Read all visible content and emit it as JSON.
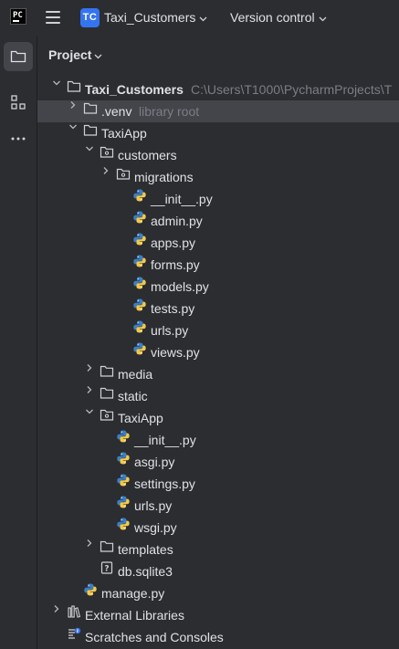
{
  "titlebar": {
    "project_badge": "TC",
    "project_name": "Taxi_Customers",
    "version_control": "Version control"
  },
  "panel": {
    "title": "Project"
  },
  "tree": [
    {
      "label": "Taxi_Customers",
      "hint": "C:\\Users\\T1000\\PycharmProjects\\T",
      "type": "folder",
      "arrow": "down",
      "bold": true
    },
    {
      "label": ".venv",
      "hint": "library root",
      "type": "folder",
      "arrow": "right",
      "selected": true
    },
    {
      "label": "TaxiApp",
      "type": "folder",
      "arrow": "down"
    },
    {
      "label": "customers",
      "type": "package",
      "arrow": "down"
    },
    {
      "label": "migrations",
      "type": "package",
      "arrow": "right"
    },
    {
      "label": "__init__.py",
      "type": "python"
    },
    {
      "label": "admin.py",
      "type": "python"
    },
    {
      "label": "apps.py",
      "type": "python"
    },
    {
      "label": "forms.py",
      "type": "python"
    },
    {
      "label": "models.py",
      "type": "python"
    },
    {
      "label": "tests.py",
      "type": "python"
    },
    {
      "label": "urls.py",
      "type": "python"
    },
    {
      "label": "views.py",
      "type": "python"
    },
    {
      "label": "media",
      "type": "folder",
      "arrow": "right"
    },
    {
      "label": "static",
      "type": "folder",
      "arrow": "right"
    },
    {
      "label": "TaxiApp",
      "type": "package",
      "arrow": "down"
    },
    {
      "label": "__init__.py",
      "type": "python"
    },
    {
      "label": "asgi.py",
      "type": "python"
    },
    {
      "label": "settings.py",
      "type": "python"
    },
    {
      "label": "urls.py",
      "type": "python"
    },
    {
      "label": "wsgi.py",
      "type": "python"
    },
    {
      "label": "templates",
      "type": "folder",
      "arrow": "right"
    },
    {
      "label": "db.sqlite3",
      "type": "unknown"
    },
    {
      "label": "manage.py",
      "type": "python"
    },
    {
      "label": "External Libraries",
      "type": "libraries",
      "arrow": "right"
    },
    {
      "label": "Scratches and Consoles",
      "type": "scratches"
    }
  ]
}
